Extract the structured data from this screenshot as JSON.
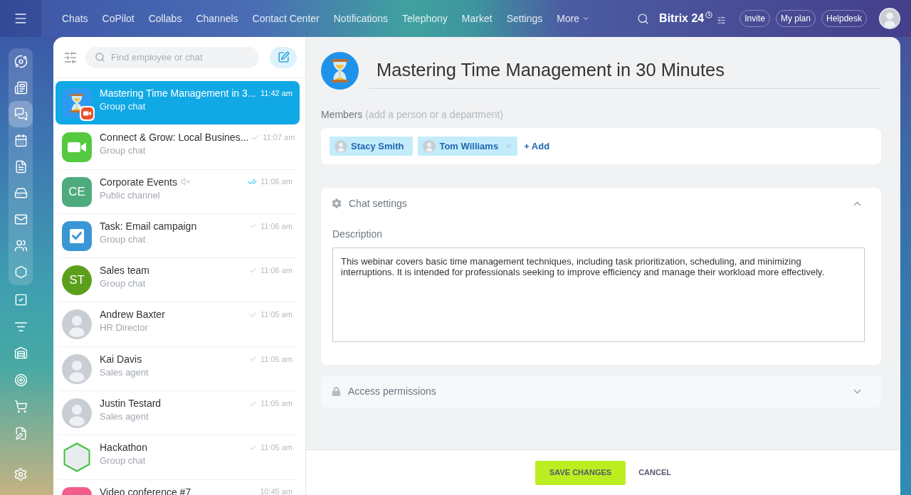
{
  "top_bar": {
    "nav": [
      "Chats",
      "CoPilot",
      "Collabs",
      "Channels",
      "Contact Center",
      "Notifications",
      "Telephony",
      "Market",
      "Settings"
    ],
    "more": "More",
    "brand": "Bitrix 24",
    "buttons": [
      "Invite",
      "My plan",
      "Helpdesk"
    ]
  },
  "sidebar": {
    "pinned_items": [
      {
        "selected": false
      },
      {
        "selected": false
      },
      {
        "selected": true
      },
      {
        "selected": false
      },
      {
        "selected": false
      },
      {
        "selected": false
      },
      {
        "selected": false
      },
      {
        "selected": false
      },
      {
        "selected": false
      }
    ],
    "items": [
      {
        "selected": false
      },
      {
        "selected": false
      },
      {
        "selected": false
      },
      {
        "selected": false
      },
      {
        "selected": false
      },
      {
        "selected": false
      }
    ]
  },
  "chat_list": {
    "search": {
      "placeholder": "Find employee or chat"
    },
    "items": [
      {
        "title": "Mastering Time Management in 3...",
        "subtitle": "Group chat",
        "time": "11:42 am",
        "selected": true,
        "tick": false,
        "muted": false,
        "in_call": true,
        "avatar": {
          "kind": "hourglass"
        }
      },
      {
        "title": "Connect & Grow: Local Busines...",
        "subtitle": "Group chat",
        "time": "11:07 am",
        "selected": false,
        "tick": true,
        "read": false,
        "muted": false,
        "in_call": false,
        "avatar": {
          "kind": "video"
        }
      },
      {
        "title": "Corporate Events",
        "subtitle": "Public channel",
        "time": "11:06 am",
        "selected": false,
        "tick": true,
        "read": true,
        "muted": true,
        "in_call": false,
        "avatar": {
          "kind": "initials",
          "initials": "CE",
          "round": false,
          "color": "#4fab7d"
        }
      },
      {
        "title": "Task: Email campaign",
        "subtitle": "Group chat",
        "time": "11:06 am",
        "selected": false,
        "tick": true,
        "read": false,
        "muted": false,
        "in_call": false,
        "avatar": {
          "kind": "task"
        }
      },
      {
        "title": "Sales team",
        "subtitle": "Group chat",
        "time": "11:06 am",
        "selected": false,
        "tick": true,
        "read": false,
        "muted": false,
        "in_call": false,
        "avatar": {
          "kind": "initials",
          "initials": "ST",
          "round": true,
          "color": "#5b9f1c"
        }
      },
      {
        "title": "Andrew Baxter",
        "subtitle": "HR Director",
        "time": "11:05 am",
        "selected": false,
        "tick": true,
        "read": false,
        "muted": false,
        "in_call": false,
        "avatar": {
          "kind": "photo"
        }
      },
      {
        "title": "Kai Davis",
        "subtitle": "Sales agent",
        "time": "11:05 am",
        "selected": false,
        "tick": true,
        "read": false,
        "muted": false,
        "in_call": false,
        "avatar": {
          "kind": "photo"
        }
      },
      {
        "title": "Justin Testard",
        "subtitle": "Sales agent",
        "time": "11:05 am",
        "selected": false,
        "tick": true,
        "read": false,
        "muted": false,
        "in_call": false,
        "avatar": {
          "kind": "photo"
        }
      },
      {
        "title": "Hackathon",
        "subtitle": "Group chat",
        "time": "11:05 am",
        "selected": false,
        "tick": true,
        "read": false,
        "muted": false,
        "in_call": false,
        "avatar": {
          "kind": "hexagon-photo"
        }
      },
      {
        "title": "Video conference #7",
        "time": "10:45 am",
        "selected": false,
        "tick": false,
        "muted": false,
        "in_call": false,
        "avatar": {
          "kind": "tile",
          "color": "#f25d8b"
        }
      }
    ]
  },
  "chat_editor": {
    "avatar": {
      "kind": "hourglass"
    },
    "title": "Mastering Time Management in 30 Minutes",
    "members_label": "Members",
    "members_hint": "(add a person or a department)",
    "members": [
      {
        "name": "Stacy Smith",
        "removable": false
      },
      {
        "name": "Tom Williams",
        "removable": true
      }
    ],
    "add_link": "+ Add",
    "sections": [
      {
        "kind": "settings",
        "title": "Chat settings",
        "expanded": true,
        "description_label": "Description",
        "description": "This webinar covers basic time management techniques, including task prioritization, scheduling, and minimizing interruptions. It is intended for professionals seeking to improve efficiency and manage their workload more effectively."
      },
      {
        "kind": "access",
        "title": "Access permissions",
        "expanded": false
      }
    ]
  },
  "footer": {
    "buttons": [
      {
        "label": "SAVE CHANGES",
        "kind": "primary"
      },
      {
        "label": "CANCEL",
        "kind": "link"
      }
    ]
  }
}
